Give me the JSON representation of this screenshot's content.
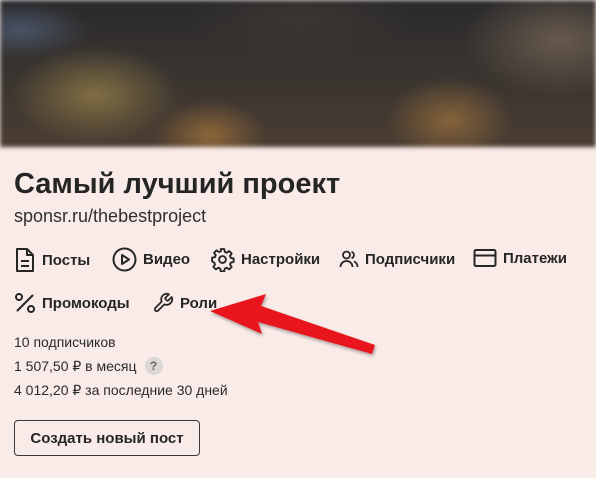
{
  "project": {
    "title": "Самый лучший проект",
    "url": "sponsr.ru/thebestproject"
  },
  "nav": {
    "posts": "Посты",
    "video": "Видео",
    "settings": "Настройки",
    "subscribers": "Подписчики",
    "payments": "Платежи",
    "promocodes": "Промокоды",
    "roles": "Роли"
  },
  "stats": {
    "subscribers": "10 подписчиков",
    "monthly": "1 507,50 ₽ в месяц",
    "help_icon": "?",
    "last30": "4 012,20 ₽ за последние 30 дней"
  },
  "actions": {
    "create_post": "Создать новый пост"
  },
  "colors": {
    "background": "#f9ebe8",
    "annotation_arrow": "#e8141e"
  },
  "icons": [
    "document-icon",
    "play-circle-icon",
    "gear-icon",
    "users-icon",
    "card-icon",
    "percent-icon",
    "wrench-icon"
  ]
}
